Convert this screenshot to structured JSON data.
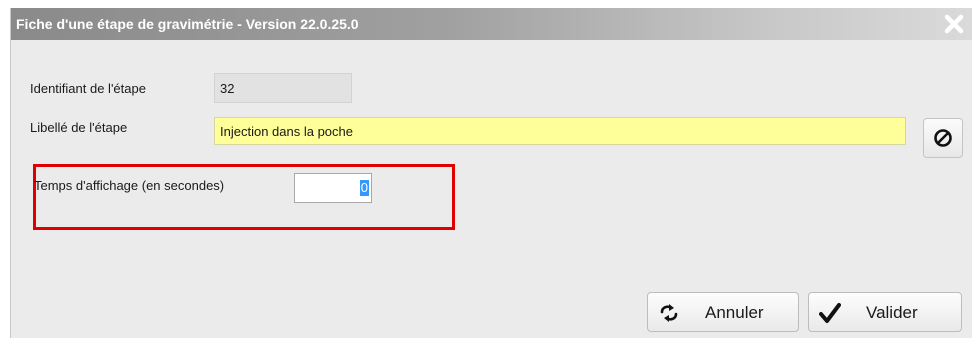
{
  "window": {
    "title": "Fiche d'une étape de gravimétrie - Version 22.0.25.0",
    "close_icon": "close-icon"
  },
  "form": {
    "identifiant": {
      "label": "Identifiant de l'étape",
      "value": "32"
    },
    "libelle": {
      "label": "Libellé de l'étape",
      "value": "Injection dans la poche",
      "clear_icon": "prohibited-icon"
    },
    "temps": {
      "label": "Temps d'affichage (en secondes)",
      "value": "0"
    }
  },
  "footer": {
    "cancel_label": "Annuler",
    "cancel_icon": "refresh-arrows-icon",
    "validate_label": "Valider",
    "validate_icon": "checkmark-icon"
  },
  "colors": {
    "highlight": "#e00000",
    "yellow_field": "#ffff99",
    "selection": "#3399ff"
  }
}
